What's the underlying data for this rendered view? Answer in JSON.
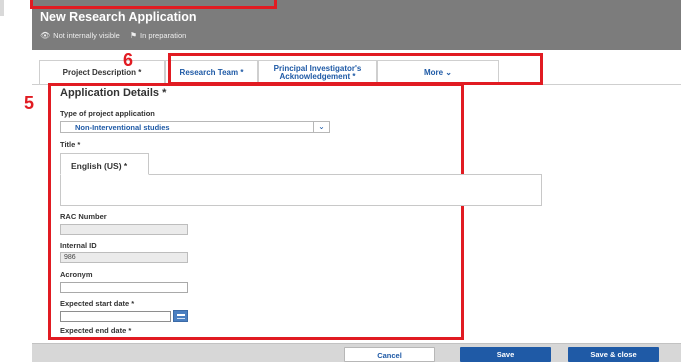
{
  "header": {
    "title": "New Research Application",
    "visibility": "Not internally visible",
    "status": "In preparation"
  },
  "tabs": [
    {
      "label": "Project Description *"
    },
    {
      "label": "Research Team *"
    },
    {
      "label": "Principal Investigator's Acknowledgement *"
    },
    {
      "label": "More ⌄"
    }
  ],
  "annotations": {
    "tabs_number": "6",
    "form_number": "5"
  },
  "form": {
    "section_title": "Application Details *",
    "type_label": "Type of project application",
    "type_value": "Non-Interventional studies",
    "title_label": "Title *",
    "title_lang_tab": "English (US) *",
    "rac_label": "RAC Number",
    "internal_id_label": "Internal ID",
    "internal_id_value": "986",
    "acronym_label": "Acronym",
    "start_label": "Expected start date *",
    "end_label": "Expected end date *"
  },
  "footer": {
    "cancel": "Cancel",
    "save": "Save",
    "save_close": "Save & close"
  },
  "colors": {
    "header_bg": "#7c7c7c",
    "link": "#1f5aa6",
    "annotation": "#e11b22",
    "primary_button": "#1f5aa6"
  }
}
